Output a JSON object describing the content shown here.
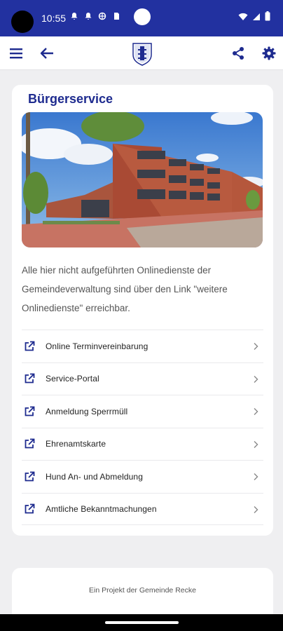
{
  "status_bar": {
    "time": "10:55",
    "icons": [
      "alarm-icon",
      "notification-icon",
      "vpn-icon",
      "sd-card-icon",
      "wifi-icon",
      "signal-icon",
      "battery-icon"
    ]
  },
  "app_bar": {
    "icons": [
      "menu-icon",
      "back-arrow-icon",
      "municipal-crest-icon",
      "share-icon",
      "settings-gear-icon"
    ],
    "accent_color": "#1e2b8f"
  },
  "card": {
    "title": "Bürgerservice",
    "intro_text": "Alle hier nicht aufgeführten Onlinedienste der Gemeindeverwaltung sind über den Link \"weitere Onlinedienste\" erreichbar.",
    "items": [
      {
        "label": "Online Terminvereinbarung",
        "icon": "external-link-icon"
      },
      {
        "label": "Service-Portal",
        "icon": "external-link-icon"
      },
      {
        "label": "Anmeldung Sperrmüll",
        "icon": "external-link-icon"
      },
      {
        "label": "Ehrenamtskarte",
        "icon": "external-link-icon"
      },
      {
        "label": "Hund An- und Abmeldung",
        "icon": "external-link-icon"
      },
      {
        "label": "Amtliche Bekanntmachungen",
        "icon": "external-link-icon"
      }
    ]
  },
  "footer": {
    "text": "Ein Projekt der Gemeinde Recke"
  }
}
